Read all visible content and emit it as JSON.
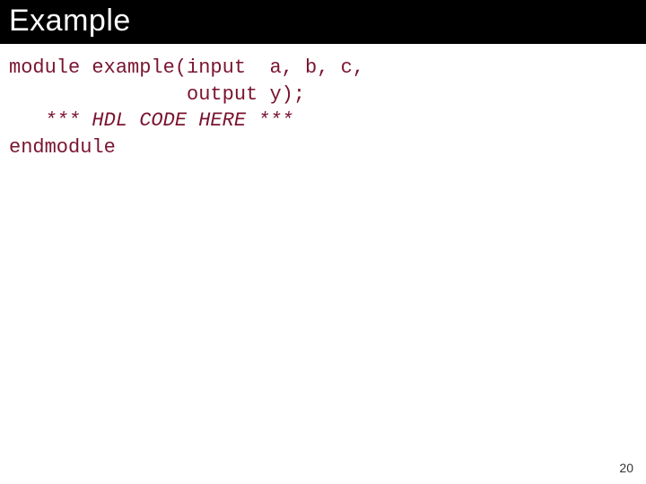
{
  "title": "Example",
  "code": {
    "l1": "module example(input  a, b, c,",
    "l2": "               output y);",
    "l3": "   *** HDL CODE HERE ***",
    "l4": "endmodule"
  },
  "page_number": "20"
}
